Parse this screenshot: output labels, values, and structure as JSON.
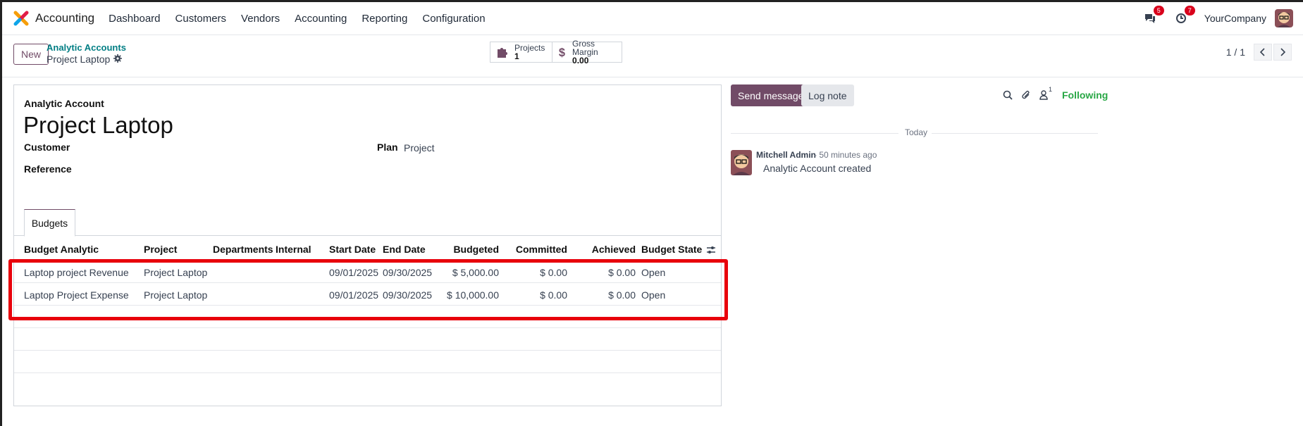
{
  "app": {
    "name": "Accounting"
  },
  "nav": [
    "Dashboard",
    "Customers",
    "Vendors",
    "Accounting",
    "Reporting",
    "Configuration"
  ],
  "systray": {
    "messages_count": "5",
    "activities_count": "7",
    "company": "YourCompany"
  },
  "control": {
    "new_label": "New",
    "breadcrumb_parent": "Analytic Accounts",
    "breadcrumb_current": "Project Laptop",
    "stats": [
      {
        "label": "Projects",
        "value": "1",
        "icon": "puzzle-icon"
      },
      {
        "label": "Gross Margin",
        "value": "0.00",
        "icon": "dollar-icon"
      }
    ],
    "pager": "1 / 1"
  },
  "form": {
    "kicker": "Analytic Account",
    "title": "Project Laptop",
    "customer_label": "Customer",
    "reference_label": "Reference",
    "plan_label": "Plan",
    "plan_value": "Project",
    "tab": "Budgets"
  },
  "table": {
    "columns": [
      "Budget Analytic",
      "Project",
      "Departments",
      "Internal",
      "Start Date",
      "End Date",
      "Budgeted",
      "Committed",
      "Achieved",
      "Budget State"
    ],
    "rows": [
      {
        "budget": "Laptop project Revenue",
        "project": "Project Laptop",
        "departments": "",
        "internal": "",
        "start": "09/01/2025",
        "end": "09/30/2025",
        "budgeted": "$ 5,000.00",
        "committed": "$ 0.00",
        "achieved": "$ 0.00",
        "state": "Open"
      },
      {
        "budget": "Laptop Project Expense",
        "project": "Project Laptop",
        "departments": "",
        "internal": "",
        "start": "09/01/2025",
        "end": "09/30/2025",
        "budgeted": "$ 10,000.00",
        "committed": "$ 0.00",
        "achieved": "$ 0.00",
        "state": "Open"
      }
    ]
  },
  "chatter": {
    "send_label": "Send message",
    "log_label": "Log note",
    "followers_count": "1",
    "following_label": "Following",
    "today_label": "Today",
    "message": {
      "author": "Mitchell Admin",
      "meta": "- 50 minutes ago",
      "body": "Analytic Account created"
    }
  },
  "colors": {
    "brand": "#714b67",
    "link": "#017e84",
    "following": "#28a745",
    "highlight": "#e8000b",
    "badge": "#d9001b"
  }
}
